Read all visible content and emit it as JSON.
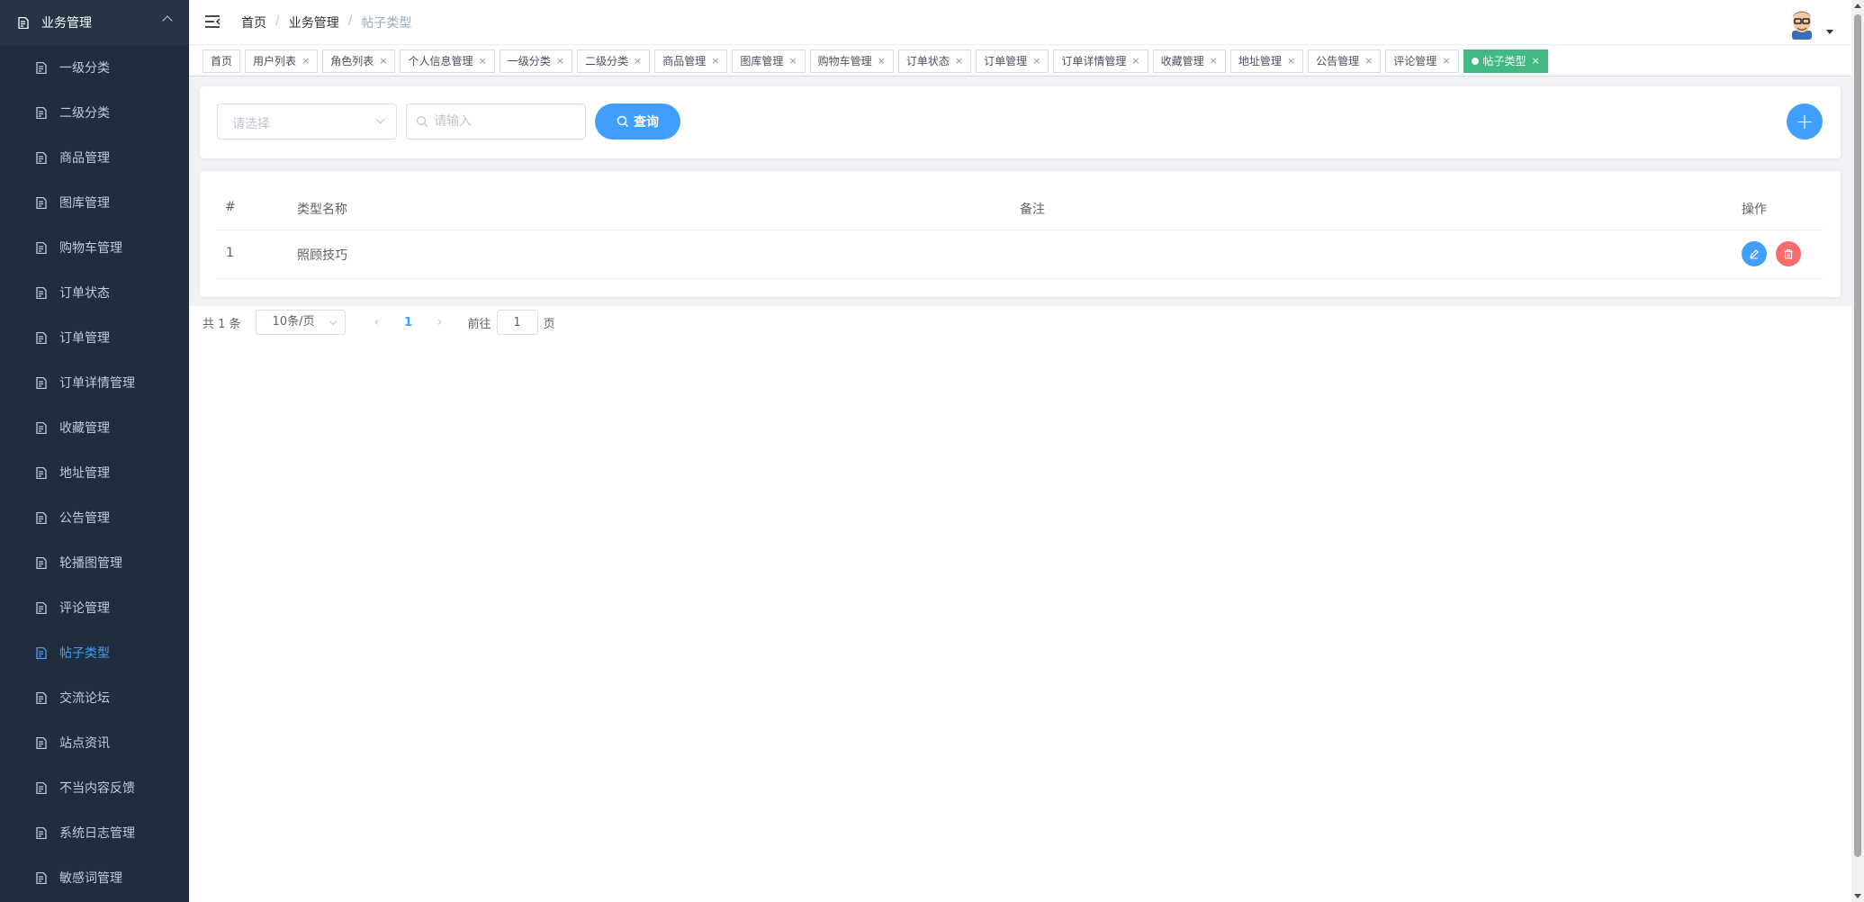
{
  "sidebar": {
    "header_label": "业务管理",
    "items": [
      {
        "label": "一级分类"
      },
      {
        "label": "二级分类"
      },
      {
        "label": "商品管理"
      },
      {
        "label": "图库管理"
      },
      {
        "label": "购物车管理"
      },
      {
        "label": "订单状态"
      },
      {
        "label": "订单管理"
      },
      {
        "label": "订单详情管理"
      },
      {
        "label": "收藏管理"
      },
      {
        "label": "地址管理"
      },
      {
        "label": "公告管理"
      },
      {
        "label": "轮播图管理"
      },
      {
        "label": "评论管理"
      },
      {
        "label": "帖子类型",
        "active": true
      },
      {
        "label": "交流论坛"
      },
      {
        "label": "站点资讯"
      },
      {
        "label": "不当内容反馈"
      },
      {
        "label": "系统日志管理"
      },
      {
        "label": "敏感词管理"
      }
    ]
  },
  "breadcrumb": [
    "首页",
    "业务管理",
    "帖子类型"
  ],
  "tags": [
    {
      "label": "首页",
      "closable": false
    },
    {
      "label": "用户列表",
      "closable": true
    },
    {
      "label": "角色列表",
      "closable": true
    },
    {
      "label": "个人信息管理",
      "closable": true
    },
    {
      "label": "一级分类",
      "closable": true
    },
    {
      "label": "二级分类",
      "closable": true
    },
    {
      "label": "商品管理",
      "closable": true
    },
    {
      "label": "图库管理",
      "closable": true
    },
    {
      "label": "购物车管理",
      "closable": true
    },
    {
      "label": "订单状态",
      "closable": true
    },
    {
      "label": "订单管理",
      "closable": true
    },
    {
      "label": "订单详情管理",
      "closable": true
    },
    {
      "label": "收藏管理",
      "closable": true
    },
    {
      "label": "地址管理",
      "closable": true
    },
    {
      "label": "公告管理",
      "closable": true
    },
    {
      "label": "评论管理",
      "closable": true
    },
    {
      "label": "帖子类型",
      "closable": true,
      "active": true
    }
  ],
  "search": {
    "select_placeholder": "请选择",
    "input_placeholder": "请输入",
    "query_label": "查询",
    "add_label": "+"
  },
  "table": {
    "headers": {
      "index": "#",
      "name": "类型名称",
      "remark": "备注",
      "actions": "操作"
    },
    "rows": [
      {
        "index": "1",
        "name": "照顾技巧",
        "remark": ""
      }
    ]
  },
  "pagination": {
    "total": "共 1 条",
    "page_size": "10条/页",
    "current_page": "1",
    "goto_prefix": "前往",
    "goto_value": "1",
    "goto_suffix": "页"
  },
  "colors": {
    "sidebar_bg": "#1f2d3d",
    "primary": "#409eff",
    "danger": "#f56c6c",
    "active_tag": "#42b983"
  }
}
